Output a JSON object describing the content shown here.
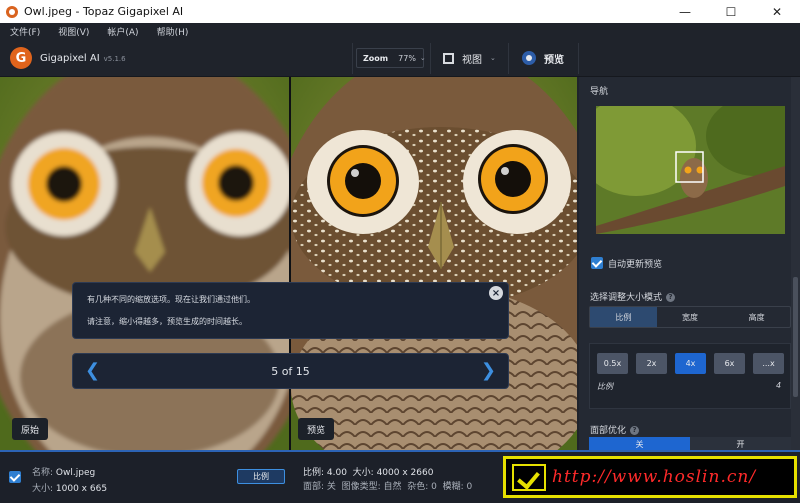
{
  "window": {
    "title": "Owl.jpeg - Topaz Gigapixel AI",
    "minimize": "—",
    "maximize": "☐",
    "close": "✕"
  },
  "menu": [
    "文件(F)",
    "视图(V)",
    "帐户(A)",
    "帮助(H)"
  ],
  "header": {
    "logo_letter": "G",
    "app_name": "Gigapixel AI",
    "version": "v5.1.6",
    "zoom_label": "Zoom",
    "zoom_value": "77%",
    "view_label": "视图",
    "preview_label": "预览"
  },
  "panes": {
    "left_label": "原始",
    "right_label": "预览"
  },
  "tooltip": {
    "line1": "有几种不同的缩放选项。现在让我们通过他们。",
    "line2": "请注意，缩小得越多，预览生成的时间越长。",
    "pager": "5 of 15",
    "prev": "❮",
    "next": "❯",
    "close": "×"
  },
  "sidebar": {
    "nav_title": "导航",
    "auto_update": "自动更新预览",
    "resize_mode_title": "选择调整大小模式",
    "resize_tabs": [
      "比例",
      "宽度",
      "高度"
    ],
    "scale_buttons": [
      "0.5x",
      "2x",
      "4x",
      "6x",
      "...x"
    ],
    "scale_selected": "4x",
    "scale_label": "比例",
    "scale_value": "4",
    "face_title": "面部优化",
    "face_off": "关",
    "face_on": "开"
  },
  "bottom": {
    "name_label": "名称:",
    "name_value": "Owl.jpeg",
    "size_label": "大小:",
    "size_value": "1000 x 665",
    "mode_badge": "比例",
    "ratio": "比例: 4.00",
    "out_size": "大小: 4000 x 2660",
    "face": "面部: 关",
    "img_type": "图像类型: 自然",
    "noise": "杂色: 0",
    "blur": "模糊: 0"
  },
  "watermark": "http://www.hoslin.cn/",
  "colors": {
    "accent": "#2f7fd1",
    "brand": "#e0641c",
    "watermark_border": "#e6e000",
    "watermark_text": "#ff2a2a"
  }
}
